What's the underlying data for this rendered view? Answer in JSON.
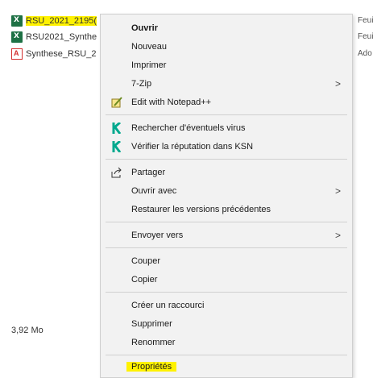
{
  "files": [
    {
      "name": "RSU_2021_2195(",
      "type": "Feui",
      "icon": "excel-icon",
      "highlighted": true
    },
    {
      "name": "RSU2021_Synthe",
      "type": "Feui",
      "icon": "excel-icon",
      "highlighted": false
    },
    {
      "name": "Synthese_RSU_2",
      "type": "Ado",
      "icon": "pdf-icon",
      "highlighted": false
    }
  ],
  "status": {
    "size": "3,92 Mo"
  },
  "menu": {
    "open": "Ouvrir",
    "new": "Nouveau",
    "print": "Imprimer",
    "zip": "7-Zip",
    "notepad": "Edit with Notepad++",
    "scan": "Rechercher d'éventuels virus",
    "ksn": "Vérifier la réputation dans KSN",
    "share": "Partager",
    "open_with": "Ouvrir avec",
    "restore": "Restaurer les versions précédentes",
    "send_to": "Envoyer vers",
    "cut": "Couper",
    "copy": "Copier",
    "shortcut": "Créer un raccourci",
    "delete": "Supprimer",
    "rename": "Renommer",
    "properties": "Propriétés",
    "submenu_arrow": ">"
  },
  "colors": {
    "highlight": "#fff200",
    "excel": "#1e7145",
    "kaspersky": "#00a88e"
  }
}
